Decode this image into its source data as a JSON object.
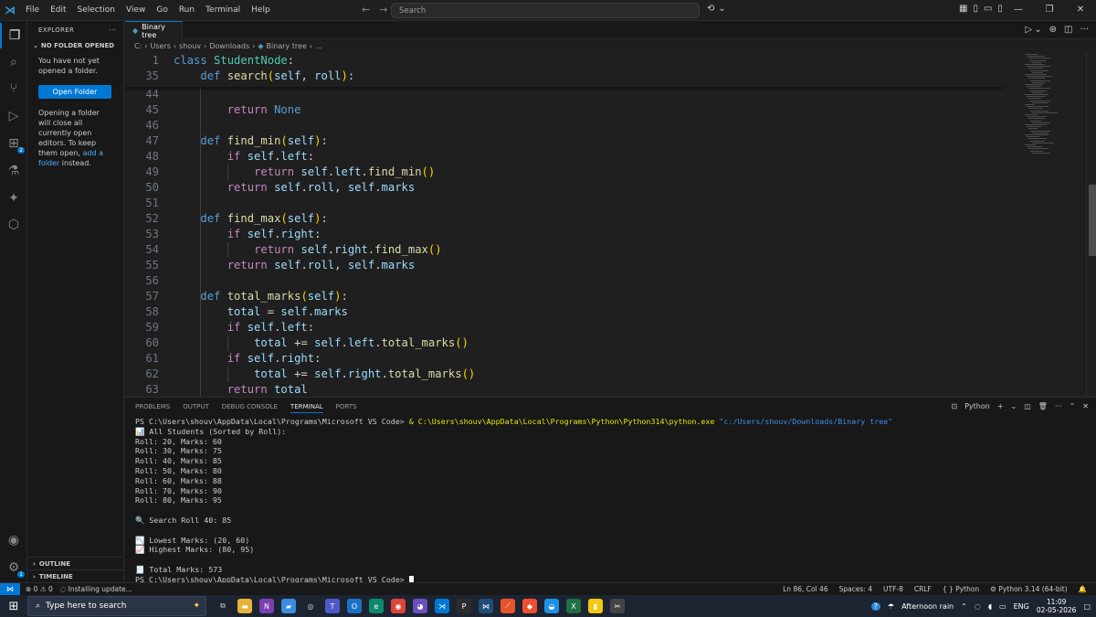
{
  "titlebar": {
    "menu": [
      "File",
      "Edit",
      "Selection",
      "View",
      "Go",
      "Run",
      "Terminal",
      "Help"
    ],
    "search_placeholder": "Search"
  },
  "sidebar": {
    "header": "EXPLORER",
    "section": "NO FOLDER OPENED",
    "message": "You have not yet opened a folder.",
    "open_folder_button": "Open Folder",
    "info_text": "Opening a folder will close all currently open editors. To keep them open,",
    "add_link": "add a folder",
    "info_suffix": "instead.",
    "outline": "OUTLINE",
    "timeline": "TIMELINE"
  },
  "editor": {
    "tab_label": "Binary tree",
    "breadcrumb": [
      "C:",
      "Users",
      "shouv",
      "Downloads",
      "Binary tree",
      "..."
    ],
    "sticky": [
      {
        "ln": "1",
        "indent": "",
        "parts": [
          [
            "kw2",
            "class "
          ],
          [
            "cls",
            "StudentNode"
          ],
          [
            "pl",
            ":"
          ]
        ]
      },
      {
        "ln": "35",
        "indent": "    ",
        "parts": [
          [
            "kw2",
            "def "
          ],
          [
            "fn",
            "search"
          ],
          [
            "pn",
            "("
          ],
          [
            "var",
            "self"
          ],
          [
            "pl",
            ", "
          ],
          [
            "var",
            "roll"
          ],
          [
            "pn",
            ")"
          ],
          [
            "pl",
            ":"
          ]
        ]
      }
    ],
    "lines": [
      {
        "ln": "44",
        "indent": "",
        "parts": []
      },
      {
        "ln": "45",
        "indent": "        ",
        "parts": [
          [
            "kw",
            "return "
          ],
          [
            "kw2",
            "None"
          ]
        ]
      },
      {
        "ln": "46",
        "indent": "",
        "parts": []
      },
      {
        "ln": "47",
        "indent": "    ",
        "parts": [
          [
            "kw2",
            "def "
          ],
          [
            "fn",
            "find_min"
          ],
          [
            "pn",
            "("
          ],
          [
            "var",
            "self"
          ],
          [
            "pn",
            ")"
          ],
          [
            "pl",
            ":"
          ]
        ]
      },
      {
        "ln": "48",
        "indent": "        ",
        "parts": [
          [
            "kw",
            "if "
          ],
          [
            "var",
            "self"
          ],
          [
            "pl",
            "."
          ],
          [
            "var",
            "left"
          ],
          [
            "pl",
            ":"
          ]
        ]
      },
      {
        "ln": "49",
        "indent": "            ",
        "parts": [
          [
            "kw",
            "return "
          ],
          [
            "var",
            "self"
          ],
          [
            "pl",
            "."
          ],
          [
            "var",
            "left"
          ],
          [
            "pl",
            "."
          ],
          [
            "fn",
            "find_min"
          ],
          [
            "pn",
            "()"
          ]
        ]
      },
      {
        "ln": "50",
        "indent": "        ",
        "parts": [
          [
            "kw",
            "return "
          ],
          [
            "var",
            "self"
          ],
          [
            "pl",
            "."
          ],
          [
            "var",
            "roll"
          ],
          [
            "pl",
            ", "
          ],
          [
            "var",
            "self"
          ],
          [
            "pl",
            "."
          ],
          [
            "var",
            "marks"
          ]
        ]
      },
      {
        "ln": "51",
        "indent": "",
        "parts": []
      },
      {
        "ln": "52",
        "indent": "    ",
        "parts": [
          [
            "kw2",
            "def "
          ],
          [
            "fn",
            "find_max"
          ],
          [
            "pn",
            "("
          ],
          [
            "var",
            "self"
          ],
          [
            "pn",
            ")"
          ],
          [
            "pl",
            ":"
          ]
        ]
      },
      {
        "ln": "53",
        "indent": "        ",
        "parts": [
          [
            "kw",
            "if "
          ],
          [
            "var",
            "self"
          ],
          [
            "pl",
            "."
          ],
          [
            "var",
            "right"
          ],
          [
            "pl",
            ":"
          ]
        ]
      },
      {
        "ln": "54",
        "indent": "            ",
        "parts": [
          [
            "kw",
            "return "
          ],
          [
            "var",
            "self"
          ],
          [
            "pl",
            "."
          ],
          [
            "var",
            "right"
          ],
          [
            "pl",
            "."
          ],
          [
            "fn",
            "find_max"
          ],
          [
            "pn",
            "()"
          ]
        ]
      },
      {
        "ln": "55",
        "indent": "        ",
        "parts": [
          [
            "kw",
            "return "
          ],
          [
            "var",
            "self"
          ],
          [
            "pl",
            "."
          ],
          [
            "var",
            "roll"
          ],
          [
            "pl",
            ", "
          ],
          [
            "var",
            "self"
          ],
          [
            "pl",
            "."
          ],
          [
            "var",
            "marks"
          ]
        ]
      },
      {
        "ln": "56",
        "indent": "",
        "parts": []
      },
      {
        "ln": "57",
        "indent": "    ",
        "parts": [
          [
            "kw2",
            "def "
          ],
          [
            "fn",
            "total_marks"
          ],
          [
            "pn",
            "("
          ],
          [
            "var",
            "self"
          ],
          [
            "pn",
            ")"
          ],
          [
            "pl",
            ":"
          ]
        ]
      },
      {
        "ln": "58",
        "indent": "        ",
        "parts": [
          [
            "var",
            "total"
          ],
          [
            "pl",
            " = "
          ],
          [
            "var",
            "self"
          ],
          [
            "pl",
            "."
          ],
          [
            "var",
            "marks"
          ]
        ]
      },
      {
        "ln": "59",
        "indent": "        ",
        "parts": [
          [
            "kw",
            "if "
          ],
          [
            "var",
            "self"
          ],
          [
            "pl",
            "."
          ],
          [
            "var",
            "left"
          ],
          [
            "pl",
            ":"
          ]
        ]
      },
      {
        "ln": "60",
        "indent": "            ",
        "parts": [
          [
            "var",
            "total"
          ],
          [
            "pl",
            " += "
          ],
          [
            "var",
            "self"
          ],
          [
            "pl",
            "."
          ],
          [
            "var",
            "left"
          ],
          [
            "pl",
            "."
          ],
          [
            "fn",
            "total_marks"
          ],
          [
            "pn",
            "()"
          ]
        ]
      },
      {
        "ln": "61",
        "indent": "        ",
        "parts": [
          [
            "kw",
            "if "
          ],
          [
            "var",
            "self"
          ],
          [
            "pl",
            "."
          ],
          [
            "var",
            "right"
          ],
          [
            "pl",
            ":"
          ]
        ]
      },
      {
        "ln": "62",
        "indent": "            ",
        "parts": [
          [
            "var",
            "total"
          ],
          [
            "pl",
            " += "
          ],
          [
            "var",
            "self"
          ],
          [
            "pl",
            "."
          ],
          [
            "var",
            "right"
          ],
          [
            "pl",
            "."
          ],
          [
            "fn",
            "total_marks"
          ],
          [
            "pn",
            "()"
          ]
        ]
      },
      {
        "ln": "63",
        "indent": "        ",
        "parts": [
          [
            "kw",
            "return "
          ],
          [
            "var",
            "total"
          ]
        ]
      }
    ]
  },
  "panel": {
    "tabs": [
      "PROBLEMS",
      "OUTPUT",
      "DEBUG CONSOLE",
      "TERMINAL",
      "PORTS"
    ],
    "active_tab": "TERMINAL",
    "shell": "Python",
    "terminal": {
      "prompt": "PS C:\\Users\\shouv\\AppData\\Local\\Programs\\Microsoft VS Code> ",
      "cmd_amp": "& ",
      "cmd_exe": "C:\\Users\\shouv\\AppData\\Local\\Programs\\Python\\Python314\\python.exe",
      "cmd_arg": " \"c:/Users/shouv/Downloads/Binary tree\"",
      "output": [
        "📊 All Students (Sorted by Roll):",
        "Roll: 20, Marks: 60",
        "Roll: 30, Marks: 75",
        "Roll: 40, Marks: 85",
        "Roll: 50, Marks: 80",
        "Roll: 60, Marks: 88",
        "Roll: 70, Marks: 90",
        "Roll: 80, Marks: 95",
        "",
        "🔍 Search Roll 40: 85",
        "",
        "📉 Lowest Marks: (20, 60)",
        "📈 Highest Marks: (80, 95)",
        "",
        "🧾 Total Marks: 573"
      ],
      "final_prompt": "PS C:\\Users\\shouv\\AppData\\Local\\Programs\\Microsoft VS Code> "
    }
  },
  "statusbar": {
    "errors": "0",
    "warnings": "0",
    "update": "Installing update...",
    "position": "Ln 86, Col 46",
    "spaces": "Spaces: 4",
    "encoding": "UTF-8",
    "eol": "CRLF",
    "language": "Python",
    "interpreter": "Python 3.14 (64-bit)"
  },
  "taskbar": {
    "search_placeholder": "Type here to search",
    "weather": "Afternoon rain",
    "lang": "ENG",
    "time": "11:09",
    "date": "02-05-2026"
  },
  "colors": {
    "accent": "#0078d4",
    "editor_bg": "#1f1f1f",
    "panel_bg": "#181818"
  }
}
